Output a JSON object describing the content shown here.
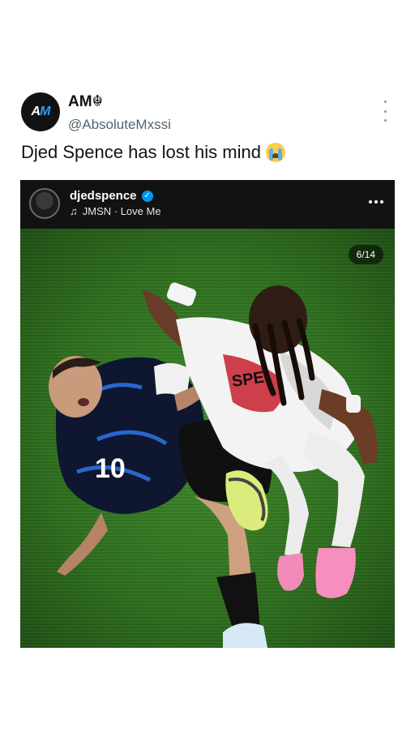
{
  "tweet": {
    "author_avatar_text": "AM",
    "author_name": "AM☬",
    "author_handle": "@AbsoluteMxssi",
    "text": "Djed Spence has lost his mind",
    "emoji": "crying-face"
  },
  "embed": {
    "username": "djedspence",
    "verified": true,
    "audio_icon": "music-note-icon",
    "audio": "JMSN · Love Me",
    "counter": "6/14",
    "photo_subject": "football-match-tackle"
  },
  "colors": {
    "handle": "#536471",
    "verified": "#0095f6",
    "pitch": "#2e6e1e",
    "blue_kit": "#0e1630",
    "white_kit": "#f3f3f3"
  }
}
